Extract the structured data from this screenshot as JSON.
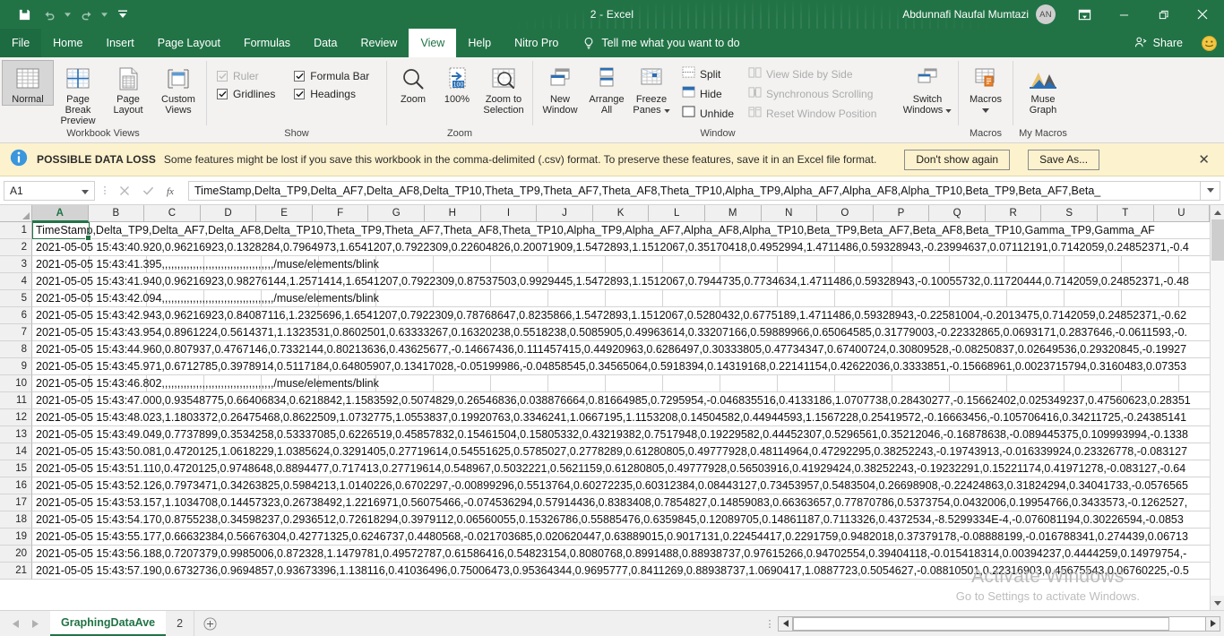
{
  "titlebar": {
    "title": "2  -  Excel",
    "user_name": "Abdunnafi Naufal Mumtazi",
    "avatar_initials": "AN",
    "save_icon": "save-icon",
    "undo_icon": "undo-icon",
    "redo_icon": "redo-icon",
    "customize_qat_icon": "customize-quick-access-toolbar-icon",
    "ribbon_display_icon": "ribbon-display-options-icon",
    "minimize_label": "–",
    "restore_label": "❐",
    "close_label": "✕",
    "accent_color": "#217346"
  },
  "tabs": [
    {
      "label": "File",
      "active": false
    },
    {
      "label": "Home",
      "active": false
    },
    {
      "label": "Insert",
      "active": false
    },
    {
      "label": "Page Layout",
      "active": false
    },
    {
      "label": "Formulas",
      "active": false
    },
    {
      "label": "Data",
      "active": false
    },
    {
      "label": "Review",
      "active": false
    },
    {
      "label": "View",
      "active": true
    },
    {
      "label": "Help",
      "active": false
    },
    {
      "label": "Nitro Pro",
      "active": false
    }
  ],
  "tellme": {
    "label": "Tell me what you want to do",
    "icon": "lightbulb-icon"
  },
  "share": {
    "label": "Share",
    "icon": "share-person-icon"
  },
  "smiley": {
    "icon": "feedback-smiley-icon"
  },
  "ribbon": {
    "groups": [
      {
        "name": "Workbook Views",
        "label": "Workbook Views",
        "buttons": [
          {
            "label_top": "Normal",
            "label_bottom": "",
            "selected": true,
            "icon": "normal-view-icon"
          },
          {
            "label_top": "Page Break",
            "label_bottom": "Preview",
            "selected": false,
            "icon": "page-break-preview-icon"
          },
          {
            "label_top": "Page",
            "label_bottom": "Layout",
            "selected": false,
            "icon": "page-layout-icon"
          },
          {
            "label_top": "Custom",
            "label_bottom": "Views",
            "selected": false,
            "icon": "custom-views-icon"
          }
        ]
      },
      {
        "name": "Show",
        "label": "Show",
        "checks": [
          {
            "label": "Ruler",
            "checked": true,
            "disabled": true
          },
          {
            "label": "Formula Bar",
            "checked": true,
            "disabled": false
          },
          {
            "label": "Gridlines",
            "checked": true,
            "disabled": false
          },
          {
            "label": "Headings",
            "checked": true,
            "disabled": false
          }
        ]
      },
      {
        "name": "Zoom",
        "label": "Zoom",
        "buttons": [
          {
            "label_top": "Zoom",
            "label_bottom": "",
            "selected": false,
            "icon": "zoom-magnifier-icon"
          },
          {
            "label_top": "100%",
            "label_bottom": "",
            "selected": false,
            "icon": "zoom-100-percent-icon"
          },
          {
            "label_top": "Zoom to",
            "label_bottom": "Selection",
            "selected": false,
            "icon": "zoom-to-selection-icon"
          }
        ]
      },
      {
        "name": "Window",
        "label": "Window",
        "buttons": [
          {
            "label_top": "New",
            "label_bottom": "Window",
            "selected": false,
            "icon": "new-window-icon"
          },
          {
            "label_top": "Arrange",
            "label_bottom": "All",
            "selected": false,
            "icon": "arrange-all-icon"
          },
          {
            "label_top": "Freeze",
            "label_bottom": "Panes",
            "selected": false,
            "icon": "freeze-panes-icon",
            "dropdown": true
          }
        ],
        "small_left": [
          {
            "label": "Split",
            "disabled": false,
            "icon": "split-icon"
          },
          {
            "label": "Hide",
            "disabled": false,
            "icon": "hide-icon"
          },
          {
            "label": "Unhide",
            "disabled": false,
            "icon": "unhide-icon"
          }
        ],
        "small_right": [
          {
            "label": "View Side by Side",
            "disabled": true,
            "icon": "view-side-by-side-icon"
          },
          {
            "label": "Synchronous Scrolling",
            "disabled": true,
            "icon": "synchronous-scrolling-icon"
          },
          {
            "label": "Reset Window Position",
            "disabled": true,
            "icon": "reset-window-position-icon"
          }
        ],
        "switch": {
          "label_top": "Switch",
          "label_bottom": "Windows",
          "icon": "switch-windows-icon",
          "dropdown": true
        }
      },
      {
        "name": "Macros",
        "label": "Macros",
        "buttons": [
          {
            "label_top": "Macros",
            "label_bottom": "",
            "selected": false,
            "icon": "macros-icon",
            "dropdown": true
          }
        ]
      },
      {
        "name": "My Macros",
        "label": "My Macros",
        "buttons": [
          {
            "label_top": "Muse",
            "label_bottom": "Graph",
            "selected": false,
            "icon": "muse-graph-icon"
          }
        ]
      }
    ]
  },
  "warning": {
    "icon": "info-icon",
    "title": "POSSIBLE DATA LOSS",
    "text": "Some features might be lost if you save this workbook in the comma-delimited (.csv) format. To preserve these features, save it in an Excel file format.",
    "dont_show_label": "Don't show again",
    "save_as_label": "Save As...",
    "close_icon": "close-icon"
  },
  "formula_bar": {
    "name_box_value": "A1",
    "name_box_caret_icon": "chevron-down-icon",
    "cancel_icon": "cancel-icon",
    "enter_icon": "enter-checkmark-icon",
    "function_icon": "insert-function-icon",
    "value": "TimeStamp,Delta_TP9,Delta_AF7,Delta_AF8,Delta_TP10,Theta_TP9,Theta_AF7,Theta_AF8,Theta_TP10,Alpha_TP9,Alpha_AF7,Alpha_AF8,Alpha_TP10,Beta_TP9,Beta_AF7,Beta_",
    "expand_icon": "chevron-down-icon"
  },
  "grid": {
    "columns": [
      "A",
      "B",
      "C",
      "D",
      "E",
      "F",
      "G",
      "H",
      "I",
      "J",
      "K",
      "L",
      "M",
      "N",
      "O",
      "P",
      "Q",
      "R",
      "S",
      "T",
      "U"
    ],
    "selected_column": "A",
    "selected_cell": "A1",
    "row_numbers": [
      1,
      2,
      3,
      4,
      5,
      6,
      7,
      8,
      9,
      10,
      11,
      12,
      13,
      14,
      15,
      16,
      17,
      18,
      19,
      20,
      21
    ],
    "rows": [
      "TimeStamp,Delta_TP9,Delta_AF7,Delta_AF8,Delta_TP10,Theta_TP9,Theta_AF7,Theta_AF8,Theta_TP10,Alpha_TP9,Alpha_AF7,Alpha_AF8,Alpha_TP10,Beta_TP9,Beta_AF7,Beta_AF8,Beta_TP10,Gamma_TP9,Gamma_AF",
      "2021-05-05 15:43:40.920,0.96216923,0.1328284,0.7964973,1.6541207,0.7922309,0.22604826,0.20071909,1.5472893,1.1512067,0.35170418,0.4952994,1.4711486,0.59328943,-0.23994637,0.07112191,0.7142059,0.24852371,-0.4",
      "2021-05-05 15:43:41.395,,,,,,,,,,,,,,,,,,,,,,,,,,,,,,,,,,,,/muse/elements/blink",
      "2021-05-05 15:43:41.940,0.96216923,0.98276144,1.2571414,1.6541207,0.7922309,0.87537503,0.9929445,1.5472893,1.1512067,0.7944735,0.7734634,1.4711486,0.59328943,-0.10055732,0.11720444,0.7142059,0.24852371,-0.48",
      "2021-05-05 15:43:42.094,,,,,,,,,,,,,,,,,,,,,,,,,,,,,,,,,,,,/muse/elements/blink",
      "2021-05-05 15:43:42.943,0.96216923,0.84087116,1.2325696,1.6541207,0.7922309,0.78768647,0.8235866,1.5472893,1.1512067,0.5280432,0.6775189,1.4711486,0.59328943,-0.22581004,-0.2013475,0.7142059,0.24852371,-0.62",
      "2021-05-05 15:43:43.954,0.8961224,0.5614371,1.1323531,0.8602501,0.63333267,0.16320238,0.5518238,0.5085905,0.49963614,0.33207166,0.59889966,0.65064585,0.31779003,-0.22332865,0.0693171,0.2837646,-0.0611593,-0.",
      "2021-05-05 15:43:44.960,0.807937,0.4767146,0.7332144,0.80213636,0.43625677,-0.14667436,0.111457415,0.44920963,0.6286497,0.30333805,0.47734347,0.67400724,0.30809528,-0.08250837,0.02649536,0.29320845,-0.19927",
      "2021-05-05 15:43:45.971,0.6712785,0.3978914,0.5117184,0.64805907,0.13417028,-0.05199986,-0.04858545,0.34565064,0.5918394,0.14319168,0.22141154,0.42622036,0.3333851,-0.15668961,0.0023715794,0.3160483,0.07353",
      "2021-05-05 15:43:46.802,,,,,,,,,,,,,,,,,,,,,,,,,,,,,,,,,,,,/muse/elements/blink",
      "2021-05-05 15:43:47.000,0.93548775,0.66406834,0.6218842,1.1583592,0.5074829,0.26546836,0.038876664,0.81664985,0.7295954,-0.046835516,0.4133186,1.0707738,0.28430277,-0.15662402,0.025349237,0.47560623,0.28351",
      "2021-05-05 15:43:48.023,1.1803372,0.26475468,0.8622509,1.0732775,1.0553837,0.19920763,0.3346241,1.0667195,1.1153208,0.14504582,0.44944593,1.1567228,0.25419572,-0.16663456,-0.105706416,0.34211725,-0.24385141",
      "2021-05-05 15:43:49.049,0.7737899,0.3534258,0.53337085,0.6226519,0.45857832,0.15461504,0.15805332,0.43219382,0.7517948,0.19229582,0.44452307,0.5296561,0.35212046,-0.16878638,-0.089445375,0.109993994,-0.1338",
      "2021-05-05 15:43:50.081,0.4720125,1.0618229,1.0385624,0.3291405,0.27719614,0.54551625,0.5785027,0.2778289,0.61280805,0.49777928,0.48114964,0.47292295,0.38252243,-0.19743913,-0.016339924,0.23326778,-0.083127",
      "2021-05-05 15:43:51.110,0.4720125,0.9748648,0.8894477,0.717413,0.27719614,0.548967,0.5032221,0.5621159,0.61280805,0.49777928,0.56503916,0.41929424,0.38252243,-0.19232291,0.15221174,0.41971278,-0.083127,-0.64",
      "2021-05-05 15:43:52.126,0.7973471,0.34263825,0.5984213,1.0140226,0.6702297,-0.00899296,0.5513764,0.60272235,0.60312384,0.08443127,0.73453957,0.5483504,0.26698908,-0.22424863,0.31824294,0.34041733,-0.0576565",
      "2021-05-05 15:43:53.157,1.1034708,0.14457323,0.26738492,1.2216971,0.56075466,-0.074536294,0.57914436,0.8383408,0.7854827,0.14859083,0.66363657,0.77870786,0.5373754,0.0432006,0.19954766,0.3433573,-0.1262527,",
      "2021-05-05 15:43:54.170,0.8755238,0.34598237,0.2936512,0.72618294,0.3979112,0.06560055,0.15326786,0.55885476,0.6359845,0.12089705,0.14861187,0.7113326,0.4372534,-8.5299334E-4,-0.076081194,0.30226594,-0.0853",
      "2021-05-05 15:43:55.177,0.66632384,0.56676304,0.42771325,0.6246737,0.4480568,-0.021703685,0.020620447,0.63889015,0.9017131,0.22454417,0.2291759,0.9482018,0.37379178,-0.08888199,-0.016788341,0.274439,0.06713",
      "2021-05-05 15:43:56.188,0.7207379,0.9985006,0.872328,1.1479781,0.49572787,0.61586416,0.54823154,0.8080768,0.8991488,0.88938737,0.97615266,0.94702554,0.39404118,-0.015418314,0.00394237,0.4444259,0.14979754,-",
      "2021-05-05 15:43:57.190,0.6732736,0.9694857,0.93673396,1.138116,0.41036496,0.75006473,0.95364344,0.9695777,0.8411269,0.88938737,1.0690417,1.0887723,0.5054627,-0.08810501,0.22316903,0.45675543,0.06760225,-0.5"
    ]
  },
  "watermark": {
    "line1": "Activate Windows",
    "line2": "Go to Settings to activate Windows."
  },
  "sheetbar": {
    "first_icon": "first-sheet-arrow-icon",
    "prev_icon": "previous-sheet-arrow-icon",
    "sheets": [
      {
        "label": "GraphingDataAve",
        "active": true
      },
      {
        "label": "2",
        "active": false
      }
    ],
    "add_sheet_icon": "add-sheet-icon",
    "hscroll_left_icon": "scroll-left-icon",
    "hscroll_right_icon": "scroll-right-icon"
  }
}
